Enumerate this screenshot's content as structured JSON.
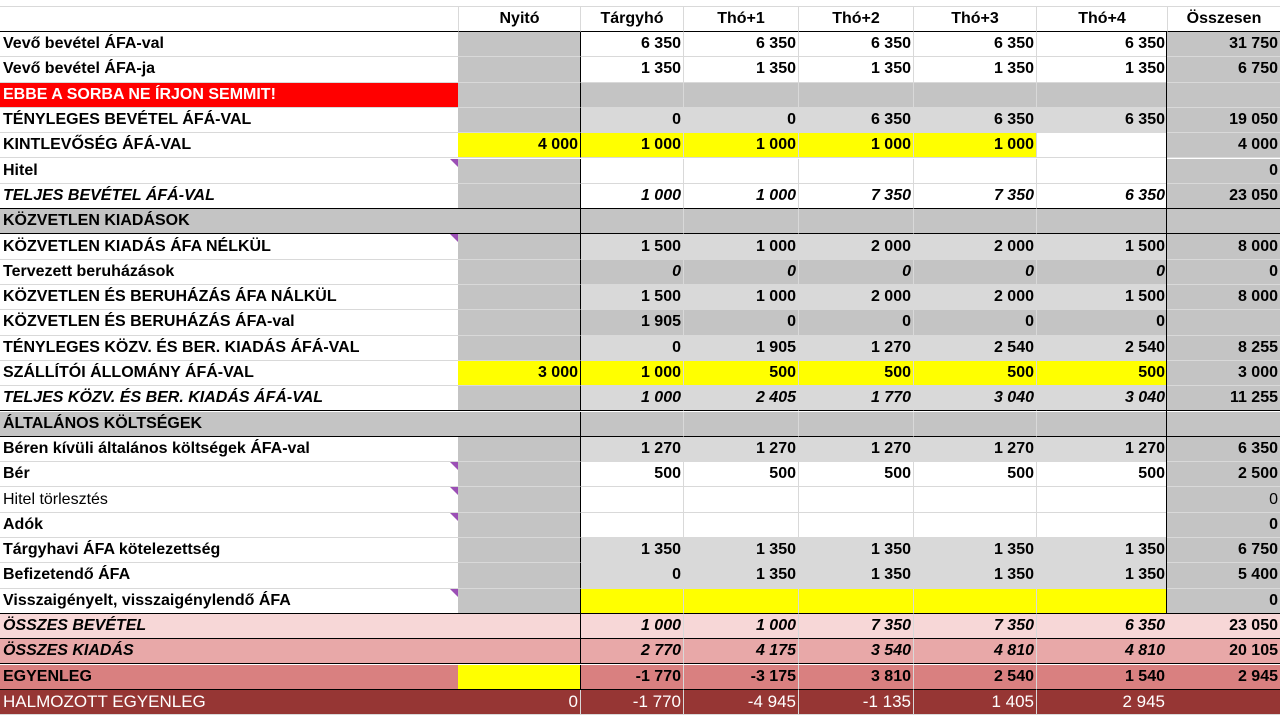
{
  "colors": {
    "gray": "#c4c4c4",
    "light_gray": "#d9d9d9",
    "yellow": "#ffff00",
    "red": "#ff0000",
    "pink_light": "#f7d7d7",
    "pink_mid": "#e8a8a8",
    "pink_dark": "#d98080",
    "maroon": "#963634",
    "note": "#9b4fb5"
  },
  "headers": [
    "Nyitó",
    "Tárgyhó",
    "Thó+1",
    "Thó+2",
    "Thó+3",
    "Thó+4",
    "Összesen"
  ],
  "rows": [
    {
      "label": "Vevő bevétel ÁFA-val",
      "values": [
        "",
        "6 350",
        "6 350",
        "6 350",
        "6 350",
        "6 350",
        "31 750"
      ]
    },
    {
      "label": "Vevő bevétel ÁFA-ja",
      "values": [
        "",
        "1 350",
        "1 350",
        "1 350",
        "1 350",
        "1 350",
        "6 750"
      ]
    },
    {
      "label": "EBBE A SORBA NE ÍRJON SEMMIT!",
      "values": [
        "",
        "",
        "",
        "",
        "",
        "",
        ""
      ]
    },
    {
      "label": "TÉNYLEGES BEVÉTEL ÁFÁ-VAL",
      "values": [
        "",
        "0",
        "0",
        "6 350",
        "6 350",
        "6 350",
        "19 050"
      ]
    },
    {
      "label": "KINTLEVŐSÉG ÁFÁ-VAL",
      "values": [
        "4 000",
        "1 000",
        "1 000",
        "1 000",
        "1 000",
        "",
        "4 000"
      ]
    },
    {
      "label": "Hitel",
      "values": [
        "",
        "",
        "",
        "",
        "",
        "",
        "0"
      ]
    },
    {
      "label": "TELJES BEVÉTEL ÁFÁ-VAL",
      "values": [
        "",
        "1 000",
        "1 000",
        "7 350",
        "7 350",
        "6 350",
        "23 050"
      ]
    },
    {
      "label": "KÖZVETLEN KIADÁSOK",
      "values": [
        "",
        "",
        "",
        "",
        "",
        "",
        ""
      ]
    },
    {
      "label": "KÖZVETLEN KIADÁS ÁFA NÉLKÜL",
      "values": [
        "",
        "1 500",
        "1 000",
        "2 000",
        "2 000",
        "1 500",
        "8 000"
      ]
    },
    {
      "label": "Tervezett beruházások",
      "values": [
        "",
        "0",
        "0",
        "0",
        "0",
        "0",
        "0"
      ]
    },
    {
      "label": "KÖZVETLEN ÉS BERUHÁZÁS ÁFA NÁLKÜL",
      "values": [
        "",
        "1 500",
        "1 000",
        "2 000",
        "2 000",
        "1 500",
        "8 000"
      ]
    },
    {
      "label": "KÖZVETLEN ÉS BERUHÁZÁS ÁFA-val",
      "values": [
        "",
        "1 905",
        "0",
        "0",
        "0",
        "0",
        ""
      ]
    },
    {
      "label": "TÉNYLEGES KÖZV. ÉS BER. KIADÁS ÁFÁ-VAL",
      "values": [
        "",
        "0",
        "1 905",
        "1 270",
        "2 540",
        "2 540",
        "8 255"
      ]
    },
    {
      "label": "SZÁLLÍTÓI ÁLLOMÁNY ÁFÁ-VAL",
      "values": [
        "3 000",
        "1 000",
        "500",
        "500",
        "500",
        "500",
        "3 000"
      ]
    },
    {
      "label": "TELJES KÖZV. ÉS BER. KIADÁS ÁFÁ-VAL",
      "values": [
        "",
        "1 000",
        "2 405",
        "1 770",
        "3 040",
        "3 040",
        "11 255"
      ]
    },
    {
      "label": "ÁLTALÁNOS KÖLTSÉGEK",
      "values": [
        "",
        "",
        "",
        "",
        "",
        "",
        ""
      ]
    },
    {
      "label": "Béren kívüli általános költségek ÁFA-val",
      "values": [
        "",
        "1 270",
        "1 270",
        "1 270",
        "1 270",
        "1 270",
        "6 350"
      ]
    },
    {
      "label": "Bér",
      "values": [
        "",
        "500",
        "500",
        "500",
        "500",
        "500",
        "2 500"
      ]
    },
    {
      "label": "Hitel törlesztés",
      "values": [
        "",
        "",
        "",
        "",
        "",
        "",
        "0"
      ]
    },
    {
      "label": "Adók",
      "values": [
        "",
        "",
        "",
        "",
        "",
        "",
        "0"
      ]
    },
    {
      "label": "Tárgyhavi ÁFA kötelezettség",
      "values": [
        "",
        "1 350",
        "1 350",
        "1 350",
        "1 350",
        "1 350",
        "6 750"
      ]
    },
    {
      "label": "Befizetendő ÁFA",
      "values": [
        "",
        "0",
        "1 350",
        "1 350",
        "1 350",
        "1 350",
        "5 400"
      ]
    },
    {
      "label": "Visszaigényelt, visszaigénylendő ÁFA",
      "values": [
        "",
        "",
        "",
        "",
        "",
        "",
        "0"
      ]
    },
    {
      "label": "ÖSSZES BEVÉTEL",
      "values": [
        "",
        "1 000",
        "1 000",
        "7 350",
        "7 350",
        "6 350",
        "23 050"
      ]
    },
    {
      "label": "ÖSSZES KIADÁS",
      "values": [
        "",
        "2 770",
        "4 175",
        "3 540",
        "4 810",
        "4 810",
        "20 105"
      ]
    },
    {
      "label": "EGYENLEG",
      "values": [
        "",
        "-1 770",
        "-3 175",
        "3 810",
        "2 540",
        "1 540",
        "2 945"
      ]
    },
    {
      "label": "HALMOZOTT EGYENLEG",
      "values": [
        "0",
        "-1 770",
        "-4 945",
        "-1 135",
        "1 405",
        "2 945",
        ""
      ]
    }
  ]
}
